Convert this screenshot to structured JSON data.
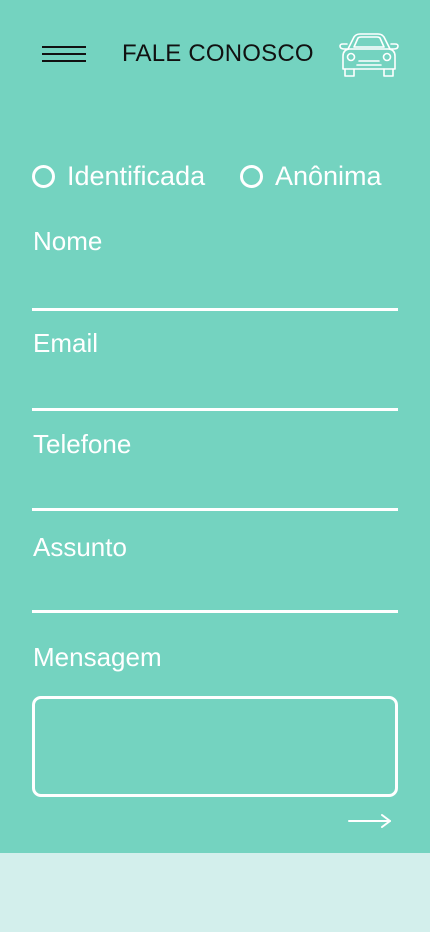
{
  "header": {
    "title": "FALE CONOSCO",
    "menu_icon": "hamburger-menu-icon",
    "logo_icon": "car-icon"
  },
  "form": {
    "identity_options": [
      {
        "label": "Identificada",
        "selected": false
      },
      {
        "label": "Anônima",
        "selected": false
      }
    ],
    "fields": {
      "name_label": "Nome",
      "email_label": "Email",
      "phone_label": "Telefone",
      "subject_label": "Assunto",
      "message_label": "Mensagem"
    },
    "submit_icon": "arrow-right-icon"
  },
  "colors": {
    "primary_background": "#74d3c0",
    "bottom_background": "#d3efec",
    "foreground": "#ffffff",
    "title_text": "#111111"
  }
}
